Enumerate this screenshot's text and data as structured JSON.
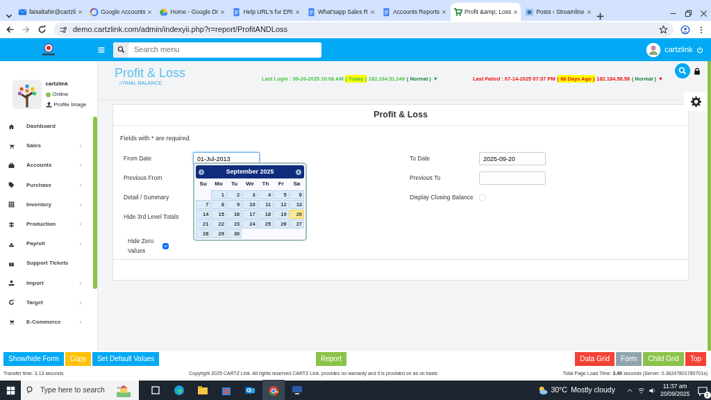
{
  "browser": {
    "tabs": [
      {
        "title": "faisaltahir@cartzli",
        "kind": "mail",
        "selected": false
      },
      {
        "title": "Google Accounts",
        "kind": "google",
        "selected": false
      },
      {
        "title": "Home - Google Dr",
        "kind": "drive",
        "selected": false
      },
      {
        "title": "Help URL's for ERI",
        "kind": "doc",
        "selected": false
      },
      {
        "title": "What'sapp Sales R",
        "kind": "doc",
        "selected": false
      },
      {
        "title": "Accounts Reports",
        "kind": "doc",
        "selected": false
      },
      {
        "title": "Profit &amp; Loss",
        "kind": "cart",
        "selected": true
      },
      {
        "title": "Posts ‹ Streamline",
        "kind": "site",
        "selected": false
      }
    ],
    "url": "demo.cartzlink.com/admin/indexyii.php?r=report/ProfitANDLoss"
  },
  "topbar": {
    "search_placeholder": "Search menu",
    "user": "cartzlink"
  },
  "profile": {
    "name": "cartzlink",
    "status": "Online",
    "upload": "Profile Image"
  },
  "sidebar": {
    "items": [
      {
        "label": "Dashboard",
        "has_children": false
      },
      {
        "label": "Sales",
        "has_children": true
      },
      {
        "label": "Accounts",
        "has_children": true
      },
      {
        "label": "Purchase",
        "has_children": true
      },
      {
        "label": "Inventory",
        "has_children": true
      },
      {
        "label": "Production",
        "has_children": true
      },
      {
        "label": "Payroll",
        "has_children": true
      },
      {
        "label": "Support Tickets",
        "has_children": false
      },
      {
        "label": "Import",
        "has_children": true
      },
      {
        "label": "Target",
        "has_children": true
      },
      {
        "label": "E-Commerce",
        "has_children": true
      }
    ]
  },
  "page": {
    "title": "Profit & Loss",
    "breadcrumb": ">TRIAL BALANCE",
    "last_login": [
      {
        "text": "Last Login : 09-20-2025 10:08 AM",
        "kind": "plain"
      },
      {
        "text": "( Today )",
        "kind": "highlight"
      },
      {
        "text": "182.184.51.249",
        "kind": "plain"
      },
      {
        "text": "( Normal )",
        "kind": "status"
      },
      {
        "text": "▼",
        "kind": "arrow"
      }
    ],
    "last_failed": [
      {
        "text": "Last Failed : 07-14-2025 07:07 PM",
        "kind": "plain"
      },
      {
        "text": "( 68 Days Ago )",
        "kind": "highlight"
      },
      {
        "text": "182.184.58.56",
        "kind": "plain"
      },
      {
        "text": "( Normal )",
        "kind": "status"
      },
      {
        "text": "▼",
        "kind": "arrow"
      }
    ]
  },
  "form": {
    "title": "Profit & Loss",
    "note": "Fields with * are required.",
    "left": [
      {
        "label": "From Date",
        "kind": "text",
        "value": "01-Jul-2013",
        "focused": true
      },
      {
        "label": "Previous From",
        "kind": "covered"
      },
      {
        "label": "Detail / Summary",
        "kind": "covered"
      },
      {
        "label": "Hide 3rd Level Totals",
        "kind": "covered"
      },
      {
        "label": "Hide Zero Values",
        "kind": "checkbox",
        "checked": true
      }
    ],
    "right": [
      {
        "label": "To Date",
        "kind": "text",
        "value": "2025-09-20",
        "focused": false
      },
      {
        "label": "Previous To",
        "kind": "text",
        "focused": false
      },
      {
        "label": "Display Closing Balance",
        "kind": "checkbox",
        "checked": false
      }
    ]
  },
  "calendar": {
    "month": "September 2025",
    "weekdays": [
      "Su",
      "Mo",
      "Tu",
      "We",
      "Th",
      "Fr",
      "Sa"
    ],
    "weeks": [
      [
        {
          "day": "1",
          "selected": false
        },
        {
          "day": "2",
          "selected": false
        },
        {
          "day": "3",
          "selected": false
        },
        {
          "day": "4",
          "selected": false
        },
        {
          "day": "5",
          "selected": false
        },
        {
          "day": "6",
          "selected": false
        }
      ],
      [
        {
          "day": "7",
          "selected": false
        },
        {
          "day": "8",
          "selected": false
        },
        {
          "day": "9",
          "selected": false
        },
        {
          "day": "10",
          "selected": false
        },
        {
          "day": "11",
          "selected": false
        },
        {
          "day": "12",
          "selected": false
        },
        {
          "day": "13",
          "selected": false
        }
      ],
      [
        {
          "day": "14",
          "selected": false
        },
        {
          "day": "15",
          "selected": false
        },
        {
          "day": "16",
          "selected": false
        },
        {
          "day": "17",
          "selected": false
        },
        {
          "day": "18",
          "selected": false
        },
        {
          "day": "19",
          "selected": false
        },
        {
          "day": "20",
          "selected": true
        }
      ],
      [
        {
          "day": "21",
          "selected": false
        },
        {
          "day": "22",
          "selected": false
        },
        {
          "day": "23",
          "selected": false
        },
        {
          "day": "24",
          "selected": false
        },
        {
          "day": "25",
          "selected": false
        },
        {
          "day": "26",
          "selected": false
        },
        {
          "day": "27",
          "selected": false
        }
      ],
      [
        {
          "day": "28",
          "selected": false
        },
        {
          "day": "29",
          "selected": false
        },
        {
          "day": "30",
          "selected": false
        }
      ]
    ]
  },
  "footer": {
    "left_buttons": [
      {
        "label": "Show/hide Form",
        "color": "#03a9f4"
      },
      {
        "label": "Copy",
        "color": "#ffc107"
      },
      {
        "label": "Set Default Values",
        "color": "#03a9f4"
      }
    ],
    "center_buttons": [
      {
        "label": "Report",
        "color": "#8bc34a"
      }
    ],
    "right_buttons": [
      {
        "label": "Data Grid",
        "color": "#f44336"
      },
      {
        "label": "Form",
        "color": "#90a4ae"
      },
      {
        "label": "Child Grid",
        "color": "#8bc34a"
      },
      {
        "label": "Top",
        "color": "#f44336"
      }
    ],
    "transfer": "Transfer time: 3.13 seconds",
    "copyright": "Copyright 2025 CARTZ Link. All rights reserved CARTZ Link. provides no warranty and it is provided on as on basis",
    "load_time": "Total Page Load Time: **3.49** seconds (Server: 0.36247801780701s)"
  },
  "taskbar": {
    "search_placeholder": "Type here to search",
    "temperature": "30°C",
    "weather": "Mostly cloudy",
    "time": "11:37 am",
    "date": "20/09/2025",
    "notifications": "2"
  }
}
